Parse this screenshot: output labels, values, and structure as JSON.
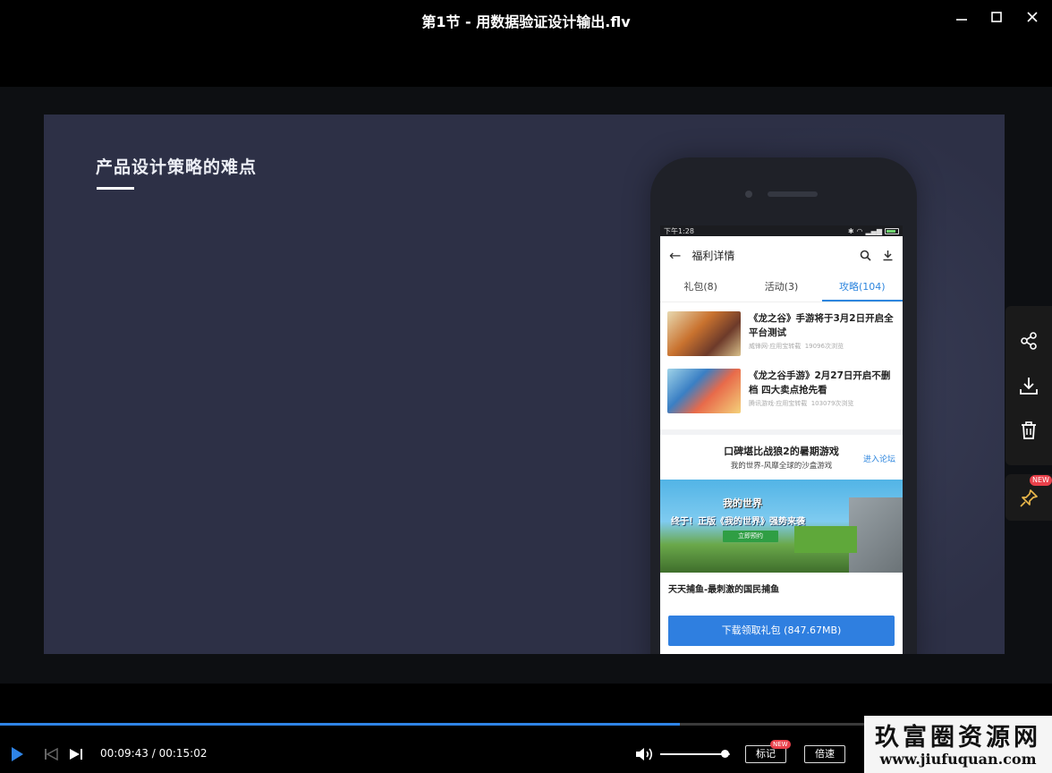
{
  "window": {
    "title": "第1节 - 用数据验证设计输出.flv"
  },
  "slide": {
    "title": "产品设计策略的难点",
    "phone": {
      "status_time": "下午1:28",
      "app_title": "福利详情",
      "tabs": [
        {
          "label": "礼包(8)",
          "active": false
        },
        {
          "label": "活动(3)",
          "active": false
        },
        {
          "label": "攻略(104)",
          "active": true
        }
      ],
      "news": [
        {
          "title": "《龙之谷》手游将于3月2日开启全平台测试",
          "source": "威锋网·应用宝转载",
          "views": "19096次浏览"
        },
        {
          "title": "《龙之谷手游》2月27日开启不删档 四大卖点抢先看",
          "source": "腾讯游戏·应用宝转载",
          "views": "103079次浏览"
        }
      ],
      "forum": {
        "title": "口碑堪比战狼2的暑期游戏",
        "subtitle": "我的世界-风靡全球的沙盒游戏",
        "link": "进入论坛"
      },
      "banner": {
        "logo": "我的世界",
        "headline": "终于！正版《我的世界》强势来袭",
        "button": "立即预约"
      },
      "game_name": "天天捕鱼-最刺激的国民捕鱼",
      "download_button": "下载领取礼包 (847.67MB)"
    }
  },
  "side_panel": {
    "pin_badge": "NEW"
  },
  "player": {
    "current_time": "00:09:43",
    "separator": " / ",
    "total_time": "00:15:02",
    "progress_fraction": 0.646,
    "volume_fraction": 0.92,
    "mark_label": "标记",
    "mark_badge": "NEW",
    "speed_label": "倍速"
  },
  "watermark": {
    "name": "玖富圈资源网",
    "url": "www.jiufuquan.com"
  },
  "colors": {
    "accent": "#2f84e6",
    "slide_bg": "#2d3046",
    "badge": "#e8404a"
  }
}
